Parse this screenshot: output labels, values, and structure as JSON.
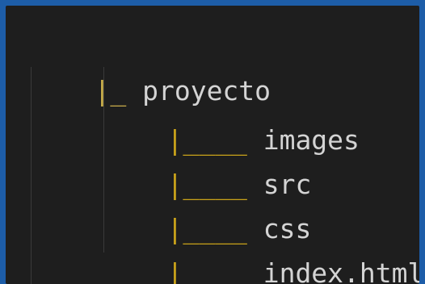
{
  "editor": {
    "lines": [
      {
        "prefix": "|_ ",
        "name": "proyecto"
      },
      {
        "prefix": "|____ ",
        "name": "images"
      },
      {
        "prefix": "|____ ",
        "name": "src"
      },
      {
        "prefix": "|____ ",
        "name": "css"
      },
      {
        "prefix": "|____ ",
        "name": "index.html"
      }
    ]
  },
  "colors": {
    "outer_border": "#1d5da8",
    "editor_background": "#1e1e1e",
    "text": "#d4d4d4",
    "tree_glyph": "#c8a21a"
  }
}
